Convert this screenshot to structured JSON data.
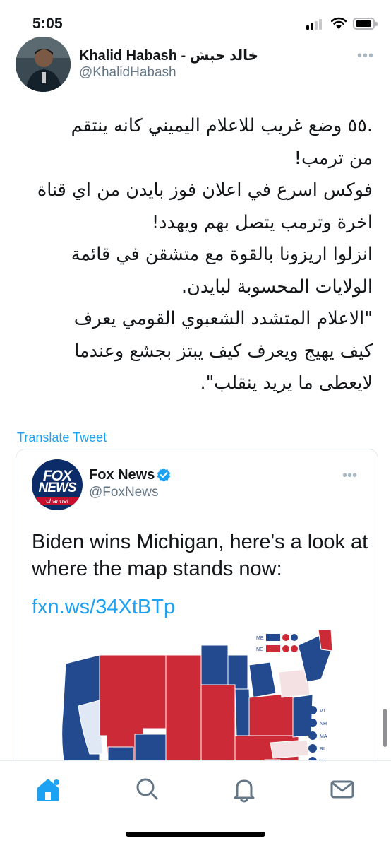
{
  "status": {
    "time": "5:05"
  },
  "tweet": {
    "author_name": "Khalid Habash - خالد حبش",
    "author_handle": "@KhalidHabash",
    "lines": [
      ".٥٥ وضع غريب للاعلام اليميني كانه ينتقم",
      "من ترمب!",
      "فوكس اسرع في اعلان فوز بايدن من اي قناة",
      "اخرة وترمب يتصل بهم ويهدد!",
      "انزلوا اريزونا بالقوة مع متشقن في قائمة",
      "الولايات المحسوبة لبايدن.",
      "\"الاعلام المتشدد الشعبوي القومي يعرف",
      "كيف يهيج ويعرف كيف يبتز بجشع وعندما",
      "لايعطى ما يريد ينقلب\"."
    ],
    "translate_label": "Translate Tweet"
  },
  "quoted": {
    "logo_fox": "FOX",
    "logo_news": "NEWS",
    "logo_channel": "channel",
    "name": "Fox News",
    "handle": "@FoxNews",
    "text": "Biden wins Michigan, here's a look at where the map stands now:",
    "link": "fxn.ws/34XtBTp"
  },
  "map_legend": {
    "me_label": "ME",
    "ne_label": "NE",
    "small_states": [
      "VT",
      "NH",
      "MA",
      "RI",
      "CT"
    ]
  },
  "colors": {
    "link": "#1da1f2",
    "democrat": "#234a8f",
    "republican": "#cc2a36",
    "undecided": "#dfe8f4",
    "secondary_text": "#657786"
  },
  "icons": {
    "home": "home-icon",
    "search": "search-icon",
    "notifications": "bell-icon",
    "messages": "envelope-icon",
    "more": "more-dots-icon",
    "verified": "verified-badge-icon"
  }
}
